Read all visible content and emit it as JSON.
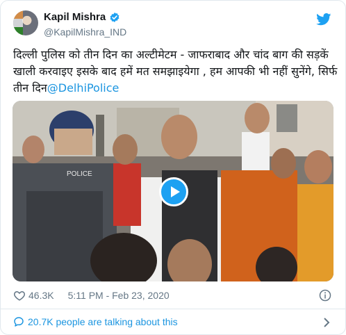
{
  "author": {
    "display_name": "Kapil Mishra",
    "handle": "@KapilMishra_IND",
    "verified": true
  },
  "tweet": {
    "line1": "दिल्ली पुलिस को तीन दिन का अल्टीमेटम - जाफराबाद और चांद बाग की सड़कें",
    "line2": "खाली करवाइए इसके बाद हमें मत समझाइयेगा , हम आपकी भी नहीं सुनेंगे, सिर्फ",
    "line3_prefix": "तीन दिन",
    "mention": "@DelhiPolice"
  },
  "media": {
    "type": "video",
    "play_icon": "play-icon",
    "sign_text": "POLICE"
  },
  "meta": {
    "likes": "46.3K",
    "timestamp": "5:11 PM - Feb 23, 2020"
  },
  "conversation": {
    "label": "20.7K people are talking about this"
  },
  "icons": {
    "verified": "verified-badge-icon",
    "brand": "twitter-bird-icon",
    "like": "heart-icon",
    "info": "info-icon",
    "comments": "speech-bubble-icon",
    "chevron": "chevron-right-icon"
  },
  "colors": {
    "link": "#1b95e0",
    "brand": "#1da1f2",
    "secondary_text": "#657786",
    "border": "#e1e8ed"
  }
}
